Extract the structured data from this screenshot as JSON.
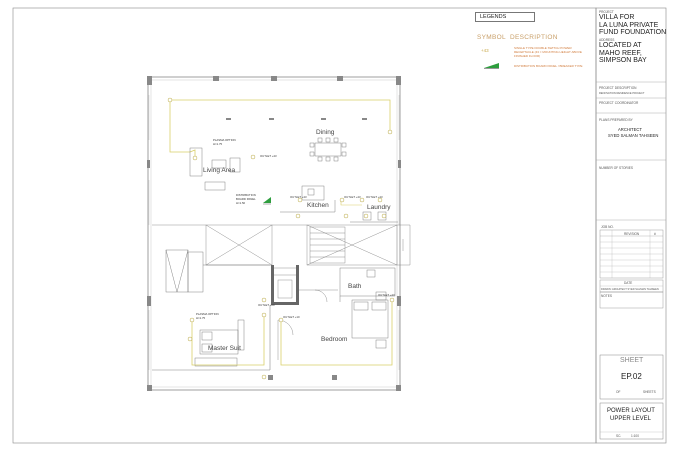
{
  "legend": {
    "title": "LEGENDS",
    "symbol_header": "SYMBOL",
    "description_header": "DESCRIPTION",
    "item1_symbol": "+43",
    "item1_text": "SINGLE TYPE DOUBLE SWITCH POWER RECEPTACLE (43 = MOUNTING HEIGHT ABOVE FINISHED FLOOR)",
    "item2_text": "DISTRIBUTION BOARD PANEL / BREAKER TYPE"
  },
  "title_block": {
    "project_label": "PROJECT",
    "project_name": [
      "VILLA FOR",
      "LA LUNA PRIVATE",
      "FUND FOUNDATION"
    ],
    "address_label": "ADDRESS",
    "address": [
      "LOCATED AT",
      "MAHO REEF,",
      "SIMPSON BAY"
    ],
    "description_label": "PROJECT DESCRIPTION",
    "description_value": "RENOVATION RESIDENCE PROJECT",
    "coordinator_label": "PROJECT COORDINATOR",
    "prepared_label": "PLANS PREPARED BY",
    "prepared_by": [
      "ARCHITECT",
      "SYED SALMAN TAHSEEN"
    ],
    "stories_label": "NUMBER OF STORIES",
    "revision_header": "REVISION",
    "revision_col": "#",
    "job_label": "JOB NO.",
    "date_label": "DATE",
    "drawn_label": "DRAWN: ARCHITECT SYED SALMAN TAHSEEN",
    "notes_label": "NOTES",
    "sheet_label": "SHEET",
    "sheet_number": "EP.02",
    "of_label": "OF",
    "sheets_label": "SHEETS",
    "drawing_title": [
      "POWER LAYOUT",
      "UPPER LEVEL"
    ],
    "scale_label": "SC.",
    "scale_value": "1:100"
  },
  "plan": {
    "rooms": {
      "dining": "Dining",
      "living": "Living Area",
      "kitchen": "Kitchen",
      "laundry": "Laundry",
      "bath": "Bath",
      "bedroom": "Bedroom",
      "master": "Master Suit"
    },
    "labels": {
      "plasma_living": "PLASMA OPTION\nH=1.75",
      "plasma_master": "PLASMA OPTION\nH=1.75",
      "outlet_43": "OUTLET +43",
      "db": "DISTRIBUTION BOARD PANEL\nH=1.50",
      "outlet_60": "OUTLET +60",
      "outlet_10": "OUTLET +10"
    }
  },
  "colors": {
    "wall": "#555555",
    "column": "#888888",
    "circuit": "#d9cf6a",
    "outlet": "#b8a740",
    "panel": "#2e9e3e",
    "legend_text": "#d07a3a"
  }
}
